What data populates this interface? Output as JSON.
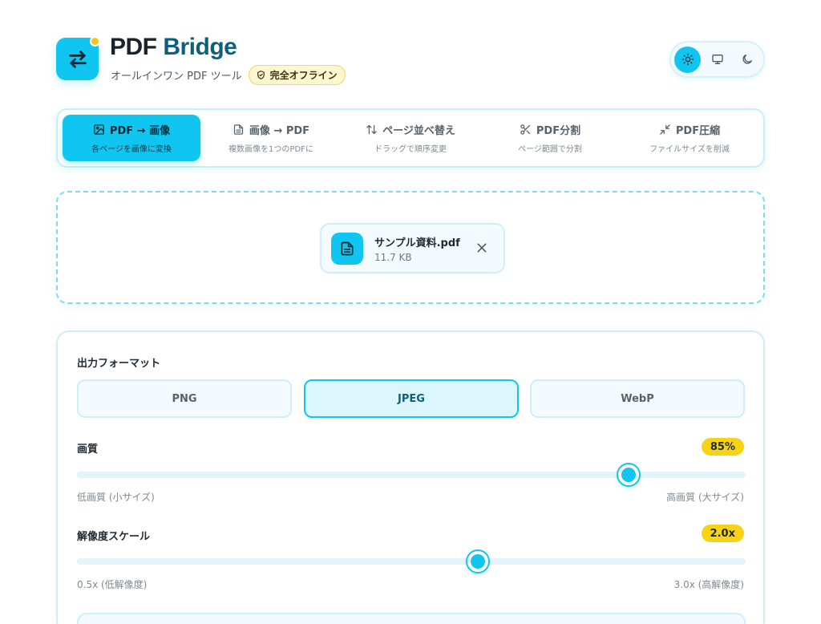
{
  "header": {
    "brand_part1": "PDF",
    "brand_part2": "Bridge",
    "subtitle": "オールインワン PDF ツール",
    "offline_badge": "完全オフライン"
  },
  "theme": {
    "options": [
      "sun-icon",
      "monitor-icon",
      "moon-icon"
    ],
    "selected": "light"
  },
  "tabs": [
    {
      "label": "PDF → 画像",
      "sub": "各ページを画像に変換",
      "icon": "image-icon",
      "active": true
    },
    {
      "label": "画像 → PDF",
      "sub": "複数画像を1つのPDFに",
      "icon": "document-icon",
      "active": false
    },
    {
      "label": "ページ並べ替え",
      "sub": "ドラッグで順序変更",
      "icon": "sort-arrows-icon",
      "active": false
    },
    {
      "label": "PDF分割",
      "sub": "ページ範囲で分割",
      "icon": "scissors-icon",
      "active": false
    },
    {
      "label": "PDF圧縮",
      "sub": "ファイルサイズを削減",
      "icon": "compress-icon",
      "active": false
    }
  ],
  "file": {
    "name": "サンプル資料.pdf",
    "size": "11.7 KB"
  },
  "settings": {
    "format_label": "出力フォーマット",
    "formats": [
      "PNG",
      "JPEG",
      "WebP"
    ],
    "selected_format": "JPEG",
    "quality": {
      "label": "画質",
      "value_text": "85%",
      "value_fraction": 0.825,
      "min_label": "低画質 (小サイズ)",
      "max_label": "高画質 (大サイズ)"
    },
    "scale": {
      "label": "解像度スケール",
      "value_text": "2.0x",
      "value_fraction": 0.6,
      "min_label": "0.5x (低解像度)",
      "max_label": "3.0x (高解像度)"
    }
  },
  "colors": {
    "accent": "#10c6f0",
    "brand_dark": "#0d5f7e",
    "badge_yellow": "#f7d316"
  }
}
